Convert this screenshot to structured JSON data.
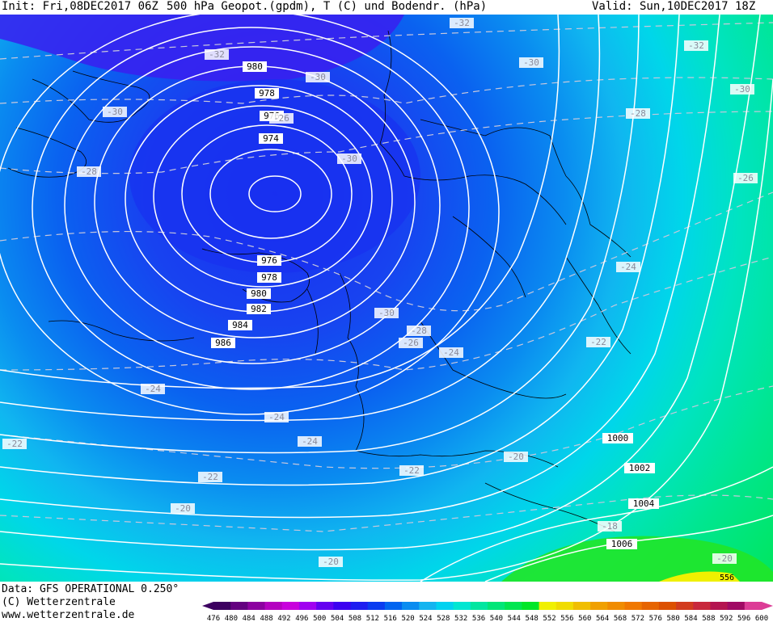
{
  "header": {
    "init": "Init: Fri,08DEC2017 06Z",
    "title": "500 hPa Geopot.(gpdm), T (C) und Bodendr. (hPa)",
    "valid": "Valid: Sun,10DEC2017 18Z"
  },
  "footer": {
    "data": "Data: GFS OPERATIONAL 0.250°",
    "copyright": "(C) Wetterzentrale",
    "url": "www.wetterzentrale.de"
  },
  "legend": {
    "levels": [
      "476",
      "480",
      "484",
      "488",
      "492",
      "496",
      "500",
      "504",
      "508",
      "512",
      "516",
      "520",
      "524",
      "528",
      "532",
      "536",
      "540",
      "544",
      "548",
      "552",
      "556",
      "560",
      "564",
      "568",
      "572",
      "576",
      "580",
      "584",
      "588",
      "592",
      "596",
      "600"
    ],
    "colors": [
      "#3c0060",
      "#640080",
      "#8c00a0",
      "#b400c0",
      "#c800dc",
      "#a000f0",
      "#6400f0",
      "#3c00f0",
      "#1e1ef0",
      "#0a3cf0",
      "#0064f0",
      "#0a8cf0",
      "#14b4f0",
      "#00d2f0",
      "#00e6d2",
      "#00e6a0",
      "#00e678",
      "#00e650",
      "#00e628",
      "#f0f000",
      "#f0dc00",
      "#f0be00",
      "#f0a000",
      "#f08c00",
      "#f07800",
      "#e66400",
      "#dc5000",
      "#d23c1e",
      "#c8283c",
      "#b41450",
      "#a00a64",
      "#dc3c96"
    ]
  },
  "map": {
    "pressure_labels": [
      {
        "text": "980"
      },
      {
        "text": "978"
      },
      {
        "text": "976"
      },
      {
        "text": "974"
      },
      {
        "text": "976"
      },
      {
        "text": "978"
      },
      {
        "text": "980"
      },
      {
        "text": "982"
      },
      {
        "text": "984"
      },
      {
        "text": "986"
      },
      {
        "text": "1000"
      },
      {
        "text": "1002"
      },
      {
        "text": "1004"
      },
      {
        "text": "1006"
      }
    ],
    "temperature_labels": [
      {
        "text": "-32"
      },
      {
        "text": "-32"
      },
      {
        "text": "-32"
      },
      {
        "text": "-30"
      },
      {
        "text": "-30"
      },
      {
        "text": "-30"
      },
      {
        "text": "-30"
      },
      {
        "text": "-28"
      },
      {
        "text": "-28"
      },
      {
        "text": "-26"
      },
      {
        "text": "-30"
      },
      {
        "text": "-26"
      },
      {
        "text": "-24"
      },
      {
        "text": "-30"
      },
      {
        "text": "-28"
      },
      {
        "text": "-26"
      },
      {
        "text": "-24"
      },
      {
        "text": "-22"
      },
      {
        "text": "-24"
      },
      {
        "text": "-24"
      },
      {
        "text": "-24"
      },
      {
        "text": "-22"
      },
      {
        "text": "-22"
      },
      {
        "text": "-22"
      },
      {
        "text": "-20"
      },
      {
        "text": "-20"
      },
      {
        "text": "-20"
      },
      {
        "text": "-20"
      },
      {
        "text": "-18"
      }
    ],
    "geopotential_partial_label": "556"
  }
}
